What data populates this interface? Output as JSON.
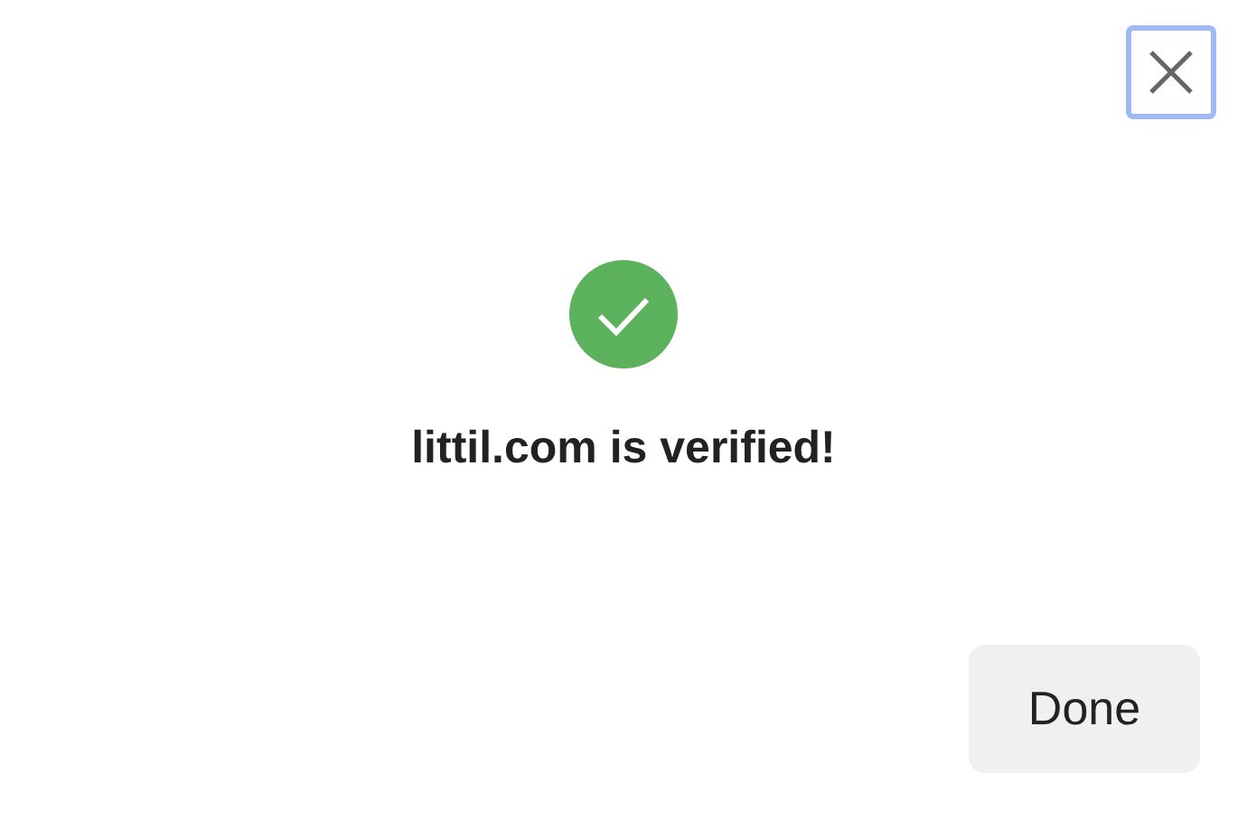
{
  "close_button": {
    "focused": true
  },
  "message": "littil.com is verified!",
  "buttons": [
    {
      "label": "Done"
    }
  ]
}
